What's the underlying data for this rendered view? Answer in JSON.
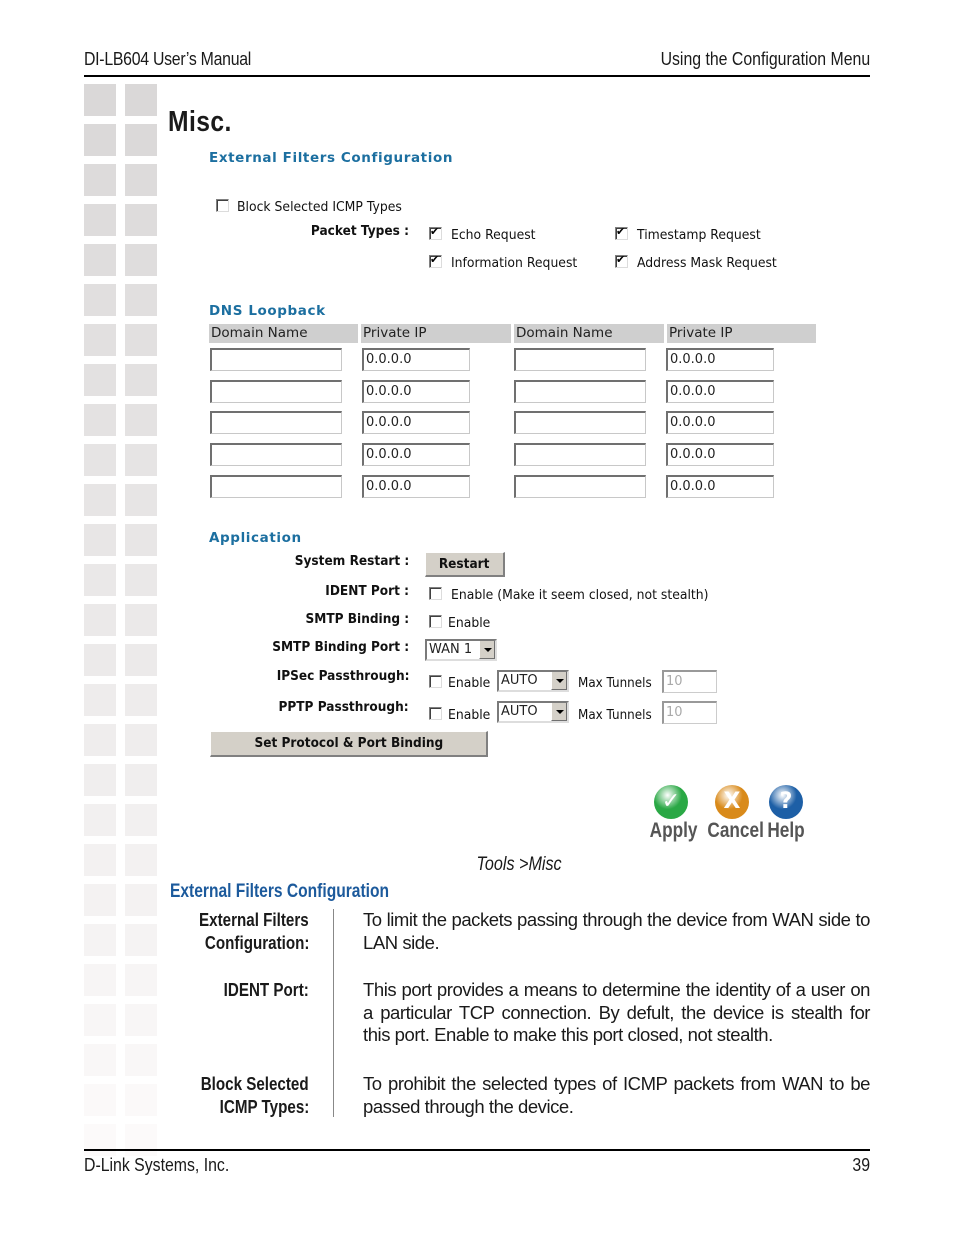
{
  "header": {
    "manual_title": "DI-LB604 User’s Manual",
    "chapter_title": "Using the Configuration Menu"
  },
  "page_title": "Misc.",
  "screenshot": {
    "external_filters": {
      "heading": "External Filters Configuration",
      "block_icmp_label": "Block Selected ICMP Types",
      "block_icmp_checked": false,
      "packet_types_label": "Packet Types :",
      "packet_types": [
        {
          "label": "Echo Request",
          "checked": true
        },
        {
          "label": "Timestamp Request",
          "checked": true
        },
        {
          "label": "Information Request",
          "checked": true
        },
        {
          "label": "Address Mask Request",
          "checked": true
        }
      ]
    },
    "dns_loopback": {
      "heading": "DNS Loopback",
      "columns": [
        "Domain Name",
        "Private IP",
        "Domain Name",
        "Private IP"
      ],
      "rows": [
        {
          "domain1": "",
          "ip1": "0.0.0.0",
          "domain2": "",
          "ip2": "0.0.0.0"
        },
        {
          "domain1": "",
          "ip1": "0.0.0.0",
          "domain2": "",
          "ip2": "0.0.0.0"
        },
        {
          "domain1": "",
          "ip1": "0.0.0.0",
          "domain2": "",
          "ip2": "0.0.0.0"
        },
        {
          "domain1": "",
          "ip1": "0.0.0.0",
          "domain2": "",
          "ip2": "0.0.0.0"
        },
        {
          "domain1": "",
          "ip1": "0.0.0.0",
          "domain2": "",
          "ip2": "0.0.0.0"
        }
      ]
    },
    "application": {
      "heading": "Application",
      "system_restart_label": "System Restart :",
      "restart_button": "Restart",
      "ident_port_label": "IDENT Port :",
      "ident_enable_label": "Enable (Make it seem closed, not stealth)",
      "smtp_binding_label": "SMTP Binding :",
      "smtp_enable_label": "Enable",
      "smtp_binding_port_label": "SMTP Binding Port :",
      "smtp_binding_port_value": "WAN 1",
      "ipsec_label": "IPSec Passthrough:",
      "ipsec_enable_label": "Enable",
      "ipsec_mode": "AUTO",
      "ipsec_max_tunnels_label": "Max Tunnels",
      "ipsec_max_tunnels": "10",
      "pptp_label": "PPTP Passthrough:",
      "pptp_enable_label": "Enable",
      "pptp_mode": "AUTO",
      "pptp_max_tunnels_label": "Max Tunnels",
      "pptp_max_tunnels": "10",
      "set_binding_button": "Set Protocol & Port Binding"
    },
    "actions": {
      "apply": {
        "label": "Apply",
        "glyph": "✓",
        "color": "#2aa845"
      },
      "cancel": {
        "label": "Cancel",
        "glyph": "X",
        "color": "#d98a1a"
      },
      "help": {
        "label": "Help",
        "glyph": "?",
        "color": "#1d5fa6"
      }
    }
  },
  "caption": "Tools >Misc",
  "description": {
    "heading": "External Filters Configuration",
    "items": [
      {
        "term": [
          "External Filters",
          "Configuration:"
        ],
        "definition": "To limit the packets passing through the device from WAN side to LAN side."
      },
      {
        "term": [
          "IDENT Port:"
        ],
        "definition": "This port provides a means to determine the identity of a user on a particular TCP connection. By defult, the device is stealth for this port. Enable to make this port closed, not stealth."
      },
      {
        "term": [
          "Block Selected",
          "ICMP Types:"
        ],
        "definition": "To prohibit the selected types of ICMP packets from WAN to be passed through the device."
      }
    ]
  },
  "footer": {
    "company": "D-Link Systems, Inc.",
    "page_number": "39"
  },
  "colors": {
    "section_heading": "#1c6fa0",
    "description_heading": "#1c5a9c"
  }
}
